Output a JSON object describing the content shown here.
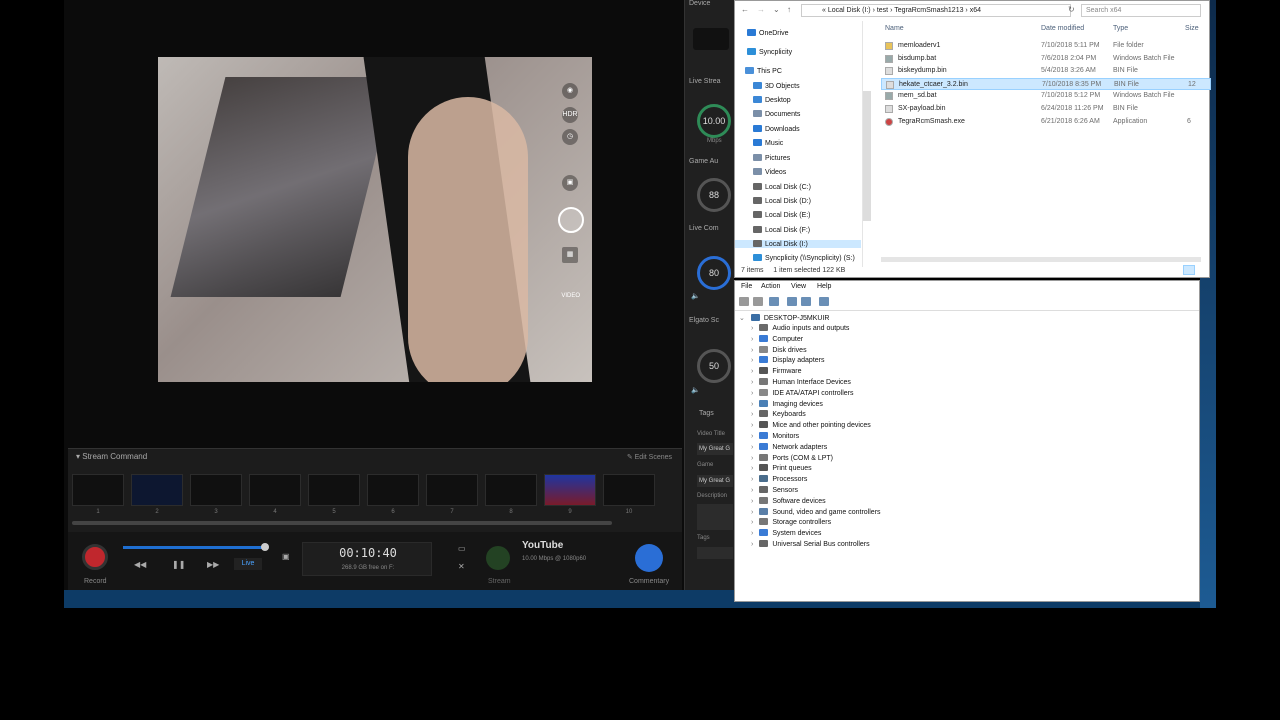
{
  "capture": {
    "device_header": "Device",
    "live_stream_header": "Live Strea",
    "bitrate_value": "10.00",
    "bitrate_unit": "Mbps",
    "game_audio_header": "Game Au",
    "game_audio_value": "88",
    "live_comm_header": "Live Com",
    "live_comm_value": "80",
    "elgato_header": "Elgato Sc",
    "elgato_value": "50",
    "tags_header": "Tags",
    "video_title_label": "Video Title",
    "video_title_value": "My Great G",
    "game_label": "Game",
    "game_value": "My Great G",
    "description_label": "Description",
    "tags_label": "Tags",
    "stream_command_title": "Stream Command",
    "edit_scenes": "Edit Scenes",
    "scene_numbers": [
      "1",
      "2",
      "3",
      "4",
      "5",
      "6",
      "7",
      "8",
      "9",
      "10"
    ],
    "record_label": "Record",
    "live_label": "Live",
    "timer": "00:10:40",
    "disk_free": "268.9 GB free on F:",
    "stream_label": "Stream",
    "youtube": "YouTube",
    "youtube_info": "10.00 Mbps @ 1080p60",
    "commentary_label": "Commentary",
    "camera_video_label": "VIDEO",
    "camera_hdr": "HDR",
    "progress": 0.97
  },
  "explorer": {
    "address": [
      "Local Disk (I:)",
      "test",
      "TegraRcmSmash1213",
      "x64"
    ],
    "search_placeholder": "Search x64",
    "columns": [
      "Name",
      "Date modified",
      "Type",
      "Size"
    ],
    "nav": [
      {
        "label": "OneDrive",
        "color": "#2a7ad5"
      },
      {
        "label": "Syncplicity",
        "color": "#2d8fd8"
      },
      {
        "label": "This PC",
        "color": "#4a90d9"
      },
      {
        "label": "3D Objects",
        "color": "#3b87d6"
      },
      {
        "label": "Desktop",
        "color": "#3b87d6"
      },
      {
        "label": "Documents",
        "color": "#7b8fa8"
      },
      {
        "label": "Downloads",
        "color": "#2a7ad5"
      },
      {
        "label": "Music",
        "color": "#2a7ad5"
      },
      {
        "label": "Pictures",
        "color": "#7b8fa8"
      },
      {
        "label": "Videos",
        "color": "#7b8fa8"
      },
      {
        "label": "Local Disk (C:)",
        "color": "#666"
      },
      {
        "label": "Local Disk (D:)",
        "color": "#666"
      },
      {
        "label": "Local Disk (E:)",
        "color": "#666"
      },
      {
        "label": "Local Disk (F:)",
        "color": "#666"
      },
      {
        "label": "Local Disk (I:)",
        "color": "#666"
      },
      {
        "label": "Syncplicity (\\\\Syncplicity) (S:)",
        "color": "#2d8fd8"
      }
    ],
    "files": [
      {
        "name": "memloaderv1",
        "date": "7/10/2018 5:11 PM",
        "type": "File folder",
        "size": "",
        "color": "#e8c35a"
      },
      {
        "name": "bisdump.bat",
        "date": "7/6/2018 2:04 PM",
        "type": "Windows Batch File",
        "size": "",
        "color": "#9aa"
      },
      {
        "name": "biskeydump.bin",
        "date": "5/4/2018 3:26 AM",
        "type": "BIN File",
        "size": "",
        "color": "#ddd"
      },
      {
        "name": "hekate_ctcaer_3.2.bin",
        "date": "7/10/2018 8:35 PM",
        "type": "BIN File",
        "size": "12",
        "color": "#ddd"
      },
      {
        "name": "mem_sd.bat",
        "date": "7/10/2018 5:12 PM",
        "type": "Windows Batch File",
        "size": "",
        "color": "#9aa"
      },
      {
        "name": "SX-payload.bin",
        "date": "6/24/2018 11:26 PM",
        "type": "BIN File",
        "size": "",
        "color": "#ddd"
      },
      {
        "name": "TegraRcmSmash.exe",
        "date": "6/21/2018 6:26 AM",
        "type": "Application",
        "size": "6",
        "color": "#c44"
      }
    ],
    "status_items": "7 items",
    "status_selected": "1 item selected  122 KB"
  },
  "devmgr": {
    "menu": [
      "File",
      "Action",
      "View",
      "Help"
    ],
    "root": "DESKTOP-J5MKUIR",
    "categories": [
      "Audio inputs and outputs",
      "Computer",
      "Disk drives",
      "Display adapters",
      "Firmware",
      "Human Interface Devices",
      "IDE ATA/ATAPI controllers",
      "Imaging devices",
      "Keyboards",
      "Mice and other pointing devices",
      "Monitors",
      "Network adapters",
      "Ports (COM & LPT)",
      "Print queues",
      "Processors",
      "Sensors",
      "Software devices",
      "Sound, video and game controllers",
      "Storage controllers",
      "System devices",
      "Universal Serial Bus controllers"
    ]
  }
}
